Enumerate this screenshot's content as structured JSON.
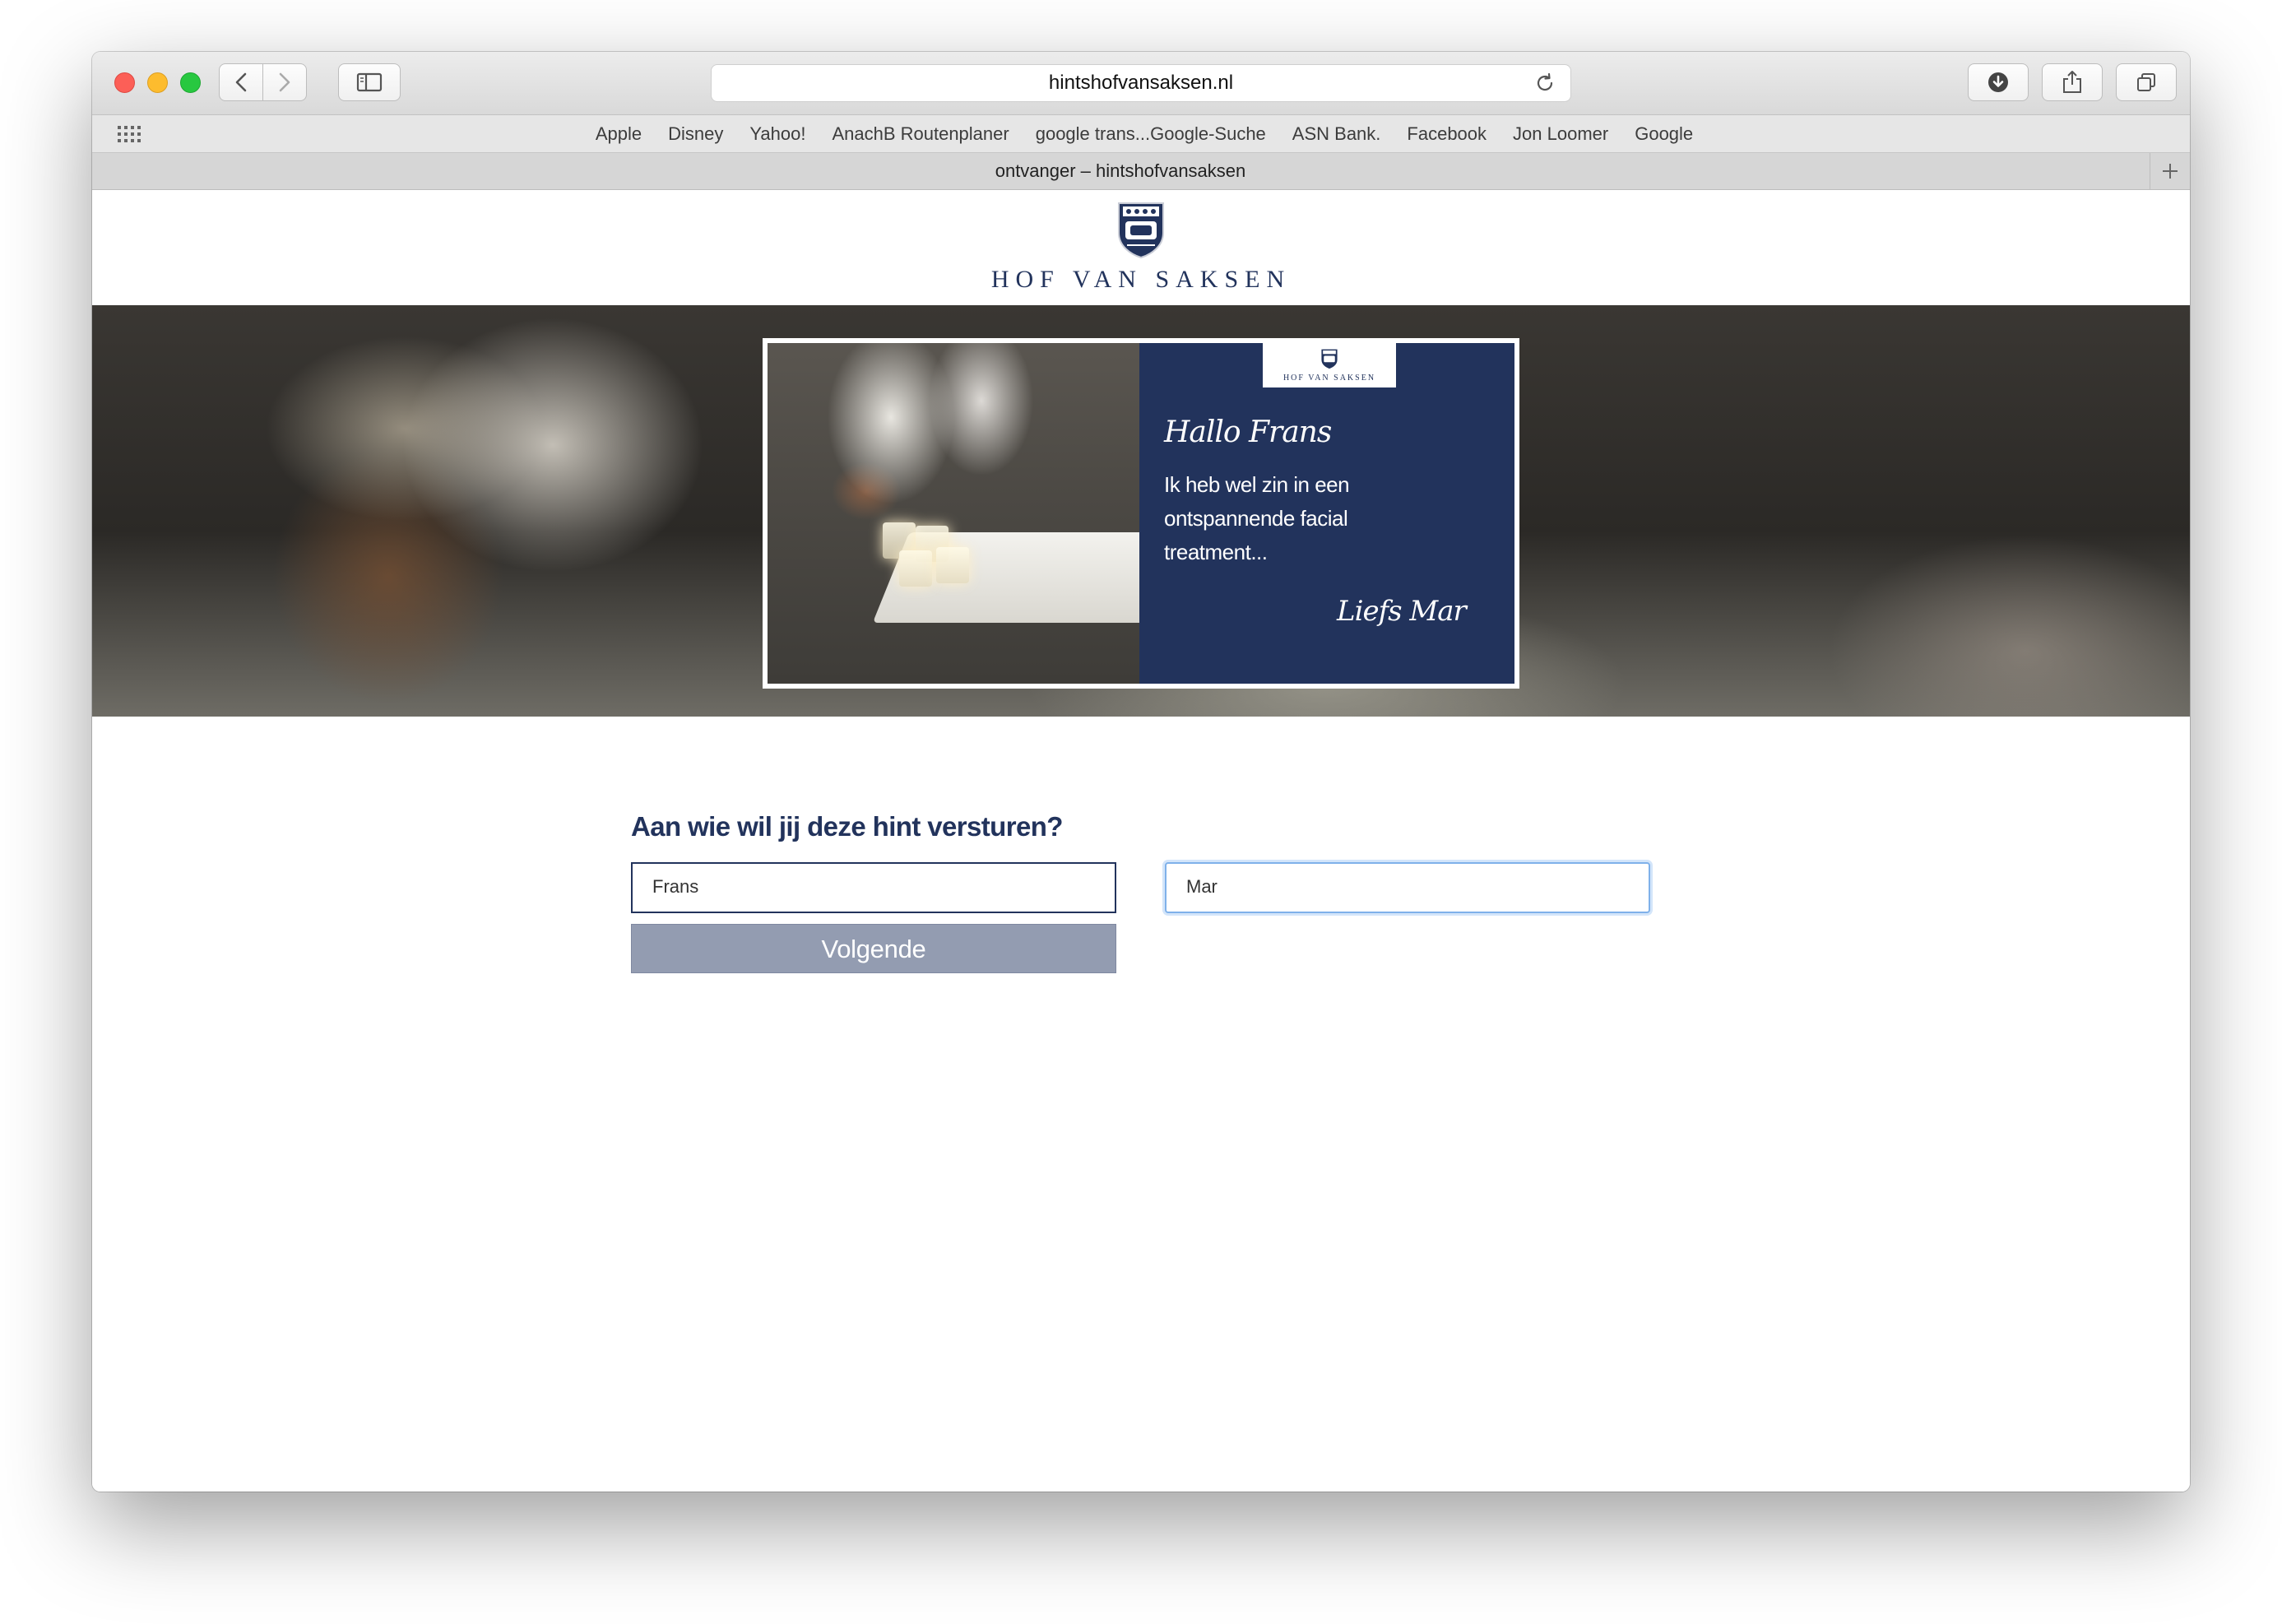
{
  "browser": {
    "url": "hintshofvansaksen.nl",
    "tab_title": "ontvanger – hintshofvansaksen",
    "bookmarks": [
      "Apple",
      "Disney",
      "Yahoo!",
      "AnachB Routenplaner",
      "google trans...Google-Suche",
      "ASN Bank.",
      "Facebook",
      "Jon Loomer",
      "Google"
    ],
    "icons": {
      "back": "chevron-left-icon",
      "forward": "chevron-right-icon",
      "sidebar": "sidebar-icon",
      "reload": "reload-icon",
      "download": "download-icon",
      "share": "share-icon",
      "tabs": "tabs-overview-icon",
      "new_tab": "plus-icon",
      "favorites": "grid-icon"
    }
  },
  "site": {
    "logo_text": "HOF VAN SAKSEN",
    "brand_color": "#22335c"
  },
  "card": {
    "logo_text": "HOF VAN SAKSEN",
    "greeting": "Hallo Frans",
    "message": "Ik heb wel zin in een ontspannende facial treatment...",
    "signoff": "Liefs Mar"
  },
  "form": {
    "heading": "Aan wie wil jij deze hint versturen?",
    "recipient_value": "Frans",
    "sender_value": "Mar",
    "next_label": "Volgende"
  }
}
